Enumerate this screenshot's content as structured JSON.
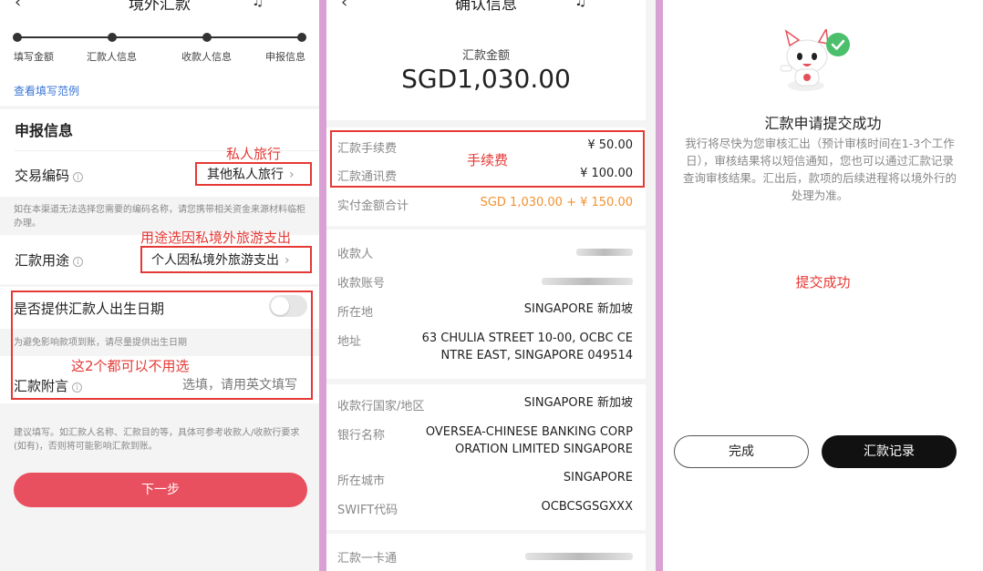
{
  "panel1": {
    "title": "境外汇款",
    "steps": [
      "填写金额",
      "汇款人信息",
      "收款人信息",
      "申报信息"
    ],
    "example_link": "查看填写范例",
    "section_title": "申报信息",
    "trade_code_label": "交易编码",
    "trade_code_value": "其他私人旅行",
    "annotation_trade": "私人旅行",
    "trade_hint": "如在本渠道无法选择您需要的编码名称，请您携带相关资金来源材料临柜办理。",
    "purpose_label": "汇款用途",
    "purpose_value": "个人因私境外旅游支出",
    "annotation_purpose": "用途选因私境外旅游支出",
    "birthdate_label": "是否提供汇款人出生日期",
    "birthdate_hint": "为避免影响款项到账，请尽量提供出生日期",
    "annotation_optional": "这2个都可以不用选",
    "remark_label": "汇款附言",
    "remark_placeholder": "选填，请用英文填写",
    "bottom_hint": "建议填写。如汇款人名称、汇款目的等，具体可参考收款人/收款行要求(如有)，否则将可能影响汇款到账。",
    "next_button": "下一步"
  },
  "panel2": {
    "title": "确认信息",
    "amount_label": "汇款金额",
    "amount_value": "SGD1,030.00",
    "fee_label": "汇款手续费",
    "fee_value": "¥ 50.00",
    "comm_fee_label": "汇款通讯费",
    "comm_fee_value": "¥ 100.00",
    "annotation_fee": "手续费",
    "total_label": "实付金额合计",
    "total_value": "SGD 1,030.00 + ¥ 150.00",
    "payee_label": "收款人",
    "account_label": "收款账号",
    "location_label": "所在地",
    "location_value": "SINGAPORE 新加坡",
    "address_label": "地址",
    "address_line1": "63 CHULIA STREET 10-00, OCBC CE",
    "address_line2": "NTRE EAST, SINGAPORE 049514",
    "bank_country_label": "收款行国家/地区",
    "bank_country_value": "SINGAPORE 新加坡",
    "bank_name_label": "银行名称",
    "bank_name_line1": "OVERSEA-CHINESE BANKING CORP",
    "bank_name_line2": "ORATION LIMITED SINGAPORE",
    "city_label": "所在城市",
    "city_value": "SINGAPORE",
    "swift_label": "SWIFT代码",
    "swift_value": "OCBCSGSGXXX",
    "card_label": "汇款一卡通"
  },
  "panel3": {
    "title": "汇款申请提交成功",
    "description": "我行将尽快为您审核汇出（预计审核时间在1-3个工作日），审核结果将以短信通知，您也可以通过汇款记录查询审核结果。汇出后，款项的后续进程将以境外行的处理为准。",
    "annotation": "提交成功",
    "done_button": "完成",
    "record_button": "汇款记录"
  },
  "colors": {
    "annotation_red": "#e53935",
    "primary_button": "#e9505f",
    "link_blue": "#3a75d6",
    "total_orange": "#f2922f",
    "separator_purple": "#d9a0d4"
  },
  "icons": [
    "back-arrow-icon",
    "headset-icon",
    "more-icon",
    "info-icon",
    "chevron-right-icon",
    "check-badge-icon"
  ]
}
